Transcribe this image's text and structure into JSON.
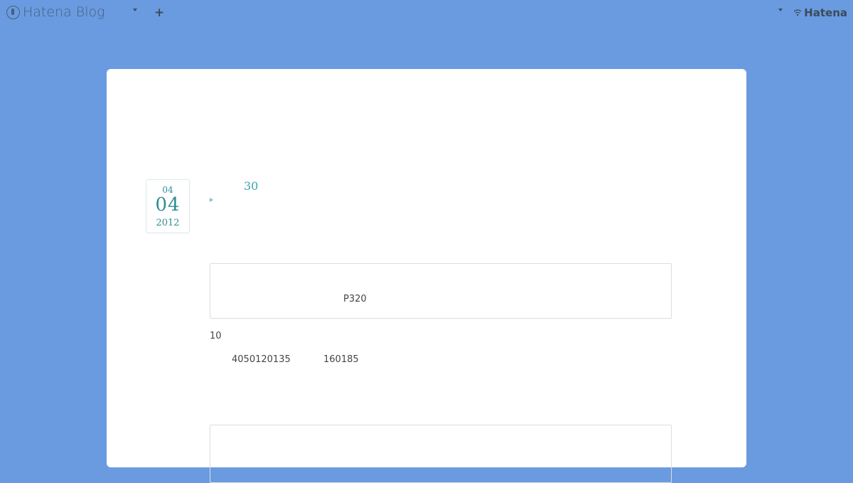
{
  "header": {
    "logo_text": "Hatena Blog",
    "hatena_label": "Hatena"
  },
  "entry": {
    "date": {
      "month": "04",
      "day": "04",
      "year": "2012"
    },
    "title": "30",
    "quote_text": "P320",
    "line1": "10",
    "line2_a": "4050120135",
    "line2_b": "160185"
  }
}
